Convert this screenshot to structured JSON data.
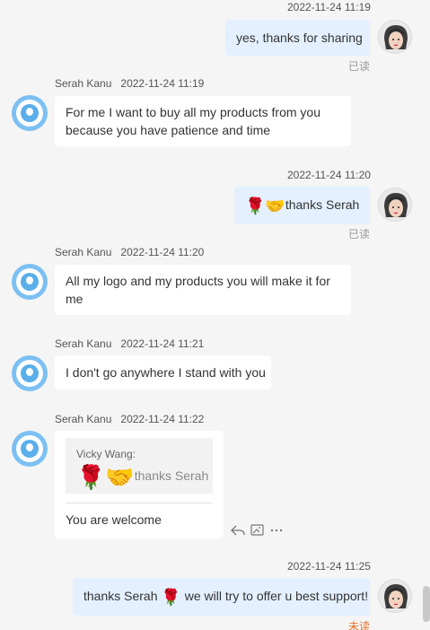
{
  "messages": [
    {
      "time": "2022-11-24 11:19",
      "text": "yes, thanks for sharing",
      "status": "已读"
    },
    {
      "sender": "Serah Kanu",
      "time": "2022-11-24 11:19",
      "text": "For me I want to buy all my products from you because you have patience and time"
    },
    {
      "time": "2022-11-24 11:20",
      "emoji1": "🌹",
      "emoji2": "🤝",
      "text": "thanks Serah",
      "status": "已读"
    },
    {
      "sender": "Serah Kanu",
      "time": "2022-11-24 11:20",
      "text": "All my logo and my products you will make it for me"
    },
    {
      "sender": "Serah Kanu",
      "time": "2022-11-24 11:21",
      "text": "I don't go anywhere I stand with you"
    },
    {
      "sender": "Serah Kanu",
      "time": "2022-11-24 11:22",
      "quote_author": "Vicky Wang:",
      "quote_emoji1": "🌹",
      "quote_emoji2": "🤝",
      "quote_text": "thanks Serah",
      "text": "You are welcome"
    },
    {
      "time": "2022-11-24 11:25",
      "text_a": "thanks Serah",
      "emoji": "🌹",
      "text_b": "we will try to offer u best support!",
      "status": "未读"
    }
  ],
  "icons": {
    "reply": "reply-icon",
    "save": "save-image-icon",
    "more": "more-icon"
  }
}
